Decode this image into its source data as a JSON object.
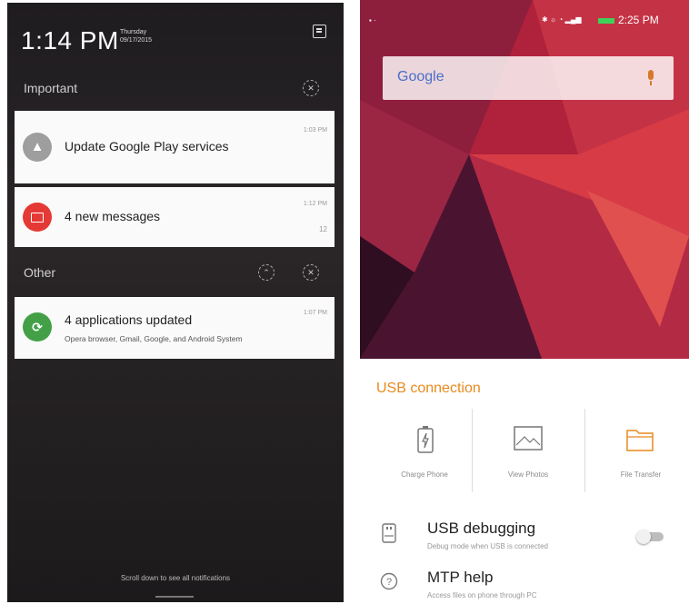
{
  "left": {
    "time": "1:14 PM",
    "day": "Thursday",
    "date": "09/17/2015",
    "sections": {
      "important": "Important",
      "other": "Other"
    },
    "notifications": [
      {
        "title": "Update Google Play services",
        "time": "1:03 PM",
        "icon_color": "#9e9e9e",
        "icon": "warning-icon"
      },
      {
        "title": "4 new messages",
        "time": "1:12 PM",
        "count": "12",
        "icon_color": "#e53935",
        "icon": "message-icon"
      },
      {
        "title": "4 applications updated",
        "time": "1:07 PM",
        "subtitle": "Opera browser, Gmail, Google, and Android System",
        "icon_color": "#43a047",
        "icon": "update-icon"
      }
    ],
    "footer": "Scroll down to see all notifications"
  },
  "right": {
    "status_time": "2:25 PM",
    "search_logo": "Google",
    "usb": {
      "title": "USB connection",
      "options": [
        "Charge Phone",
        "View Photos",
        "File Transfer"
      ],
      "accent_color": "#e88a1e"
    },
    "rows": [
      {
        "title": "USB debugging",
        "subtitle": "Debug mode when USB is connected",
        "toggle": false
      },
      {
        "title": "MTP help",
        "subtitle": "Access files on phone through PC"
      }
    ]
  }
}
